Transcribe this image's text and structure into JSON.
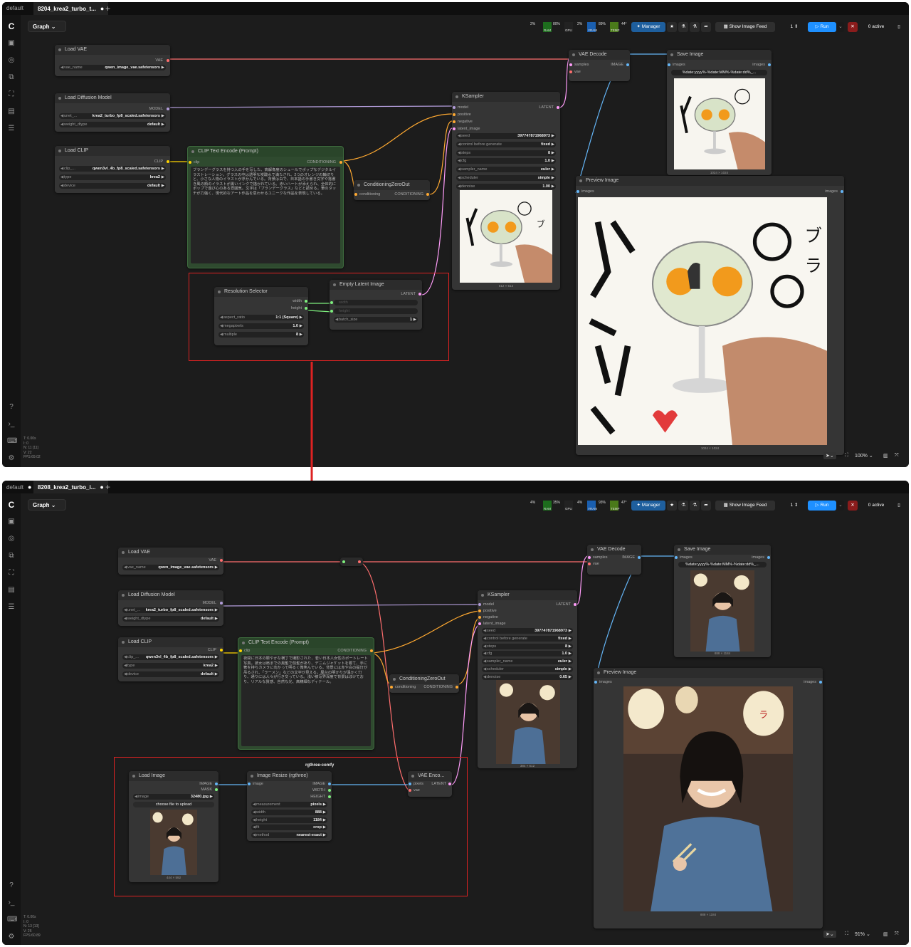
{
  "top": {
    "tabs": [
      {
        "label": "default"
      },
      {
        "label": "8204_krea2_turbo_t..."
      }
    ],
    "graph_label": "Graph",
    "stats": "T: 0.00s\nI: 0\nN: 11 [11]\nV: 22\nFPS:69.02",
    "toolbar": {
      "cpu_pct": "2%",
      "cpu_label": "CPU",
      "ram_pct": "80%",
      "ram_label": "RAM",
      "gpu_pct": "2%",
      "gpu_label": "GPU",
      "vram_pct": "89%",
      "vram_label": "VRAM",
      "temp": "44°",
      "temp_label": "TEMP",
      "manager": "Manager",
      "feed": "Show Image Feed",
      "queue": "1",
      "run": "Run",
      "active": "0 active"
    },
    "zoom": "100%",
    "nodes": {
      "load_vae": {
        "title": "Load VAE",
        "out": "VAE",
        "w_label": "vae_name",
        "w_value": "qwen_image_vae.safetensors"
      },
      "load_diffusion": {
        "title": "Load Diffusion Model",
        "out": "MODEL",
        "w1_label": "unet_...",
        "w1_value": "krea2_turbo_fp8_scaled.safetensors",
        "w2_label": "weight_dtype",
        "w2_value": "default"
      },
      "load_clip": {
        "title": "Load CLIP",
        "out": "CLIP",
        "w1_label": "clip_...",
        "w1_value": "qwen3vl_4b_fp8_scaled.safetensors",
        "w2_label": "type",
        "w2_value": "krea2",
        "w3_label": "device",
        "w3_value": "default"
      },
      "clip_text": {
        "title": "CLIP Text Encode (Prompt)",
        "in": "clip",
        "out": "CONDITIONING",
        "text": "ブランデーグラスを持つ人の手を写した、高解像度のシュールでポップなデジタルイラストレーション。グラスの中は透明な炭酸水で満たされ、2つのオレンジの輪切りと、小さな人物のイラストが浮かんでいる。背景は白で、日本語の手書き文字や落書き風の顔のイラストが黒いインクで描かれている。赤いハートが添えられ、全体的にポップで遊び心のある雰囲気。文字は「ブランデーグラス」などと読める。筆のタッチが力強く、現代的なアート作品を思わせるユニークな作品を表現している。"
      },
      "cond_zero": {
        "title": "ConditioningZeroOut",
        "in": "conditioning",
        "out": "CONDITIONING"
      },
      "ksampler": {
        "title": "KSampler",
        "in_model": "model",
        "in_positive": "positive",
        "in_negative": "negative",
        "in_latent": "latent_image",
        "out": "LATENT",
        "widgets": [
          {
            "label": "seed",
            "value": "397747871968973"
          },
          {
            "label": "control before generate",
            "value": "fixed"
          },
          {
            "label": "steps",
            "value": "8"
          },
          {
            "label": "cfg",
            "value": "1.0"
          },
          {
            "label": "sampler_name",
            "value": "euler"
          },
          {
            "label": "scheduler",
            "value": "simple"
          },
          {
            "label": "denoise",
            "value": "1.00"
          }
        ],
        "caption": "512 × 512"
      },
      "vae_decode": {
        "title": "VAE Decode",
        "in_samples": "samples",
        "in_vae": "vae",
        "out": "IMAGE"
      },
      "save_image": {
        "title": "Save Image",
        "in": "images",
        "out": "images",
        "filename": "%date:yyyy%-%date:MM%-%date:dd%_...",
        "caption": "1024 × 1024"
      },
      "preview": {
        "title": "Preview Image",
        "in": "images",
        "out": "images",
        "caption": "1024 × 1024"
      },
      "res_selector": {
        "title": "Resolution Selector",
        "out_w": "width",
        "out_h": "height",
        "widgets": [
          {
            "label": "aspect_ratio",
            "value": "1:1 (Square)"
          },
          {
            "label": "megapixels",
            "value": "1.0"
          },
          {
            "label": "multiple",
            "value": "8"
          }
        ]
      },
      "empty_latent": {
        "title": "Empty Latent Image",
        "out": "LATENT",
        "w1": "width",
        "w2": "height",
        "w3_label": "batch_size",
        "w3_value": "1"
      }
    }
  },
  "bottom": {
    "tabs": [
      {
        "label": "default"
      },
      {
        "label": "8208_krea2_turbo_i..."
      }
    ],
    "graph_label": "Graph",
    "stats": "T: 0.00s\nI: 0\nN: 13 [13]\nV: 26\nFPS:60.89",
    "toolbar": {
      "cpu_pct": "4%",
      "cpu_label": "CPU",
      "ram_pct": "35%",
      "ram_label": "RAM",
      "gpu_pct": "4%",
      "gpu_label": "GPU",
      "vram_pct": "93%",
      "vram_label": "VRAM",
      "temp": "47°",
      "temp_label": "TEMP",
      "manager": "Manager",
      "feed": "Show Image Feed",
      "queue": "1",
      "run": "Run",
      "active": "0 active"
    },
    "zoom": "91%",
    "group_label": "rgthree-comfy",
    "nodes": {
      "load_vae": {
        "title": "Load VAE",
        "out": "VAE",
        "w_label": "vae_name",
        "w_value": "qwen_image_vae.safetensors"
      },
      "load_diffusion": {
        "title": "Load Diffusion Model",
        "out": "MODEL",
        "w1_label": "unet_...",
        "w1_value": "krea2_turbo_fp8_scaled.safetensors",
        "w2_label": "weight_dtype",
        "w2_value": "default"
      },
      "load_clip": {
        "title": "Load CLIP",
        "out": "CLIP",
        "w1_label": "clip_...",
        "w1_value": "qwen3vl_4b_fp8_scaled.safetensors",
        "w2_label": "type",
        "w2_value": "krea2",
        "w3_label": "device",
        "w3_value": "default"
      },
      "clip_text": {
        "title": "CLIP Text Encode (Prompt)",
        "in": "clip",
        "out": "CONDITIONING",
        "text": "夜間に日本の賑やかな横丁で撮影された、若い日本人女性のポートレート写真。彼女は肩までの黒髪で前髪があり、デニムジャケットを着て、手に箸を持ちカメラに向かって明るく微笑んでいる。背景には赤や白の提灯が吊るされ、「ラーメン」などの文字が見える。屋台の明かりが温かく灯り、通りには人々が行き交っている。浅い被写界深度で背景はぼけており、リアルな質感、自然な光、高精細なディテール。"
      },
      "cond_zero": {
        "title": "ConditioningZeroOut",
        "in": "conditioning",
        "out": "CONDITIONING"
      },
      "ksampler": {
        "title": "KSampler",
        "in_model": "model",
        "in_positive": "positive",
        "in_negative": "negative",
        "in_latent": "latent_image",
        "out": "LATENT",
        "widgets": [
          {
            "label": "seed",
            "value": "397747871968973"
          },
          {
            "label": "control before generate",
            "value": "fixed"
          },
          {
            "label": "steps",
            "value": "8"
          },
          {
            "label": "cfg",
            "value": "1.0"
          },
          {
            "label": "sampler_name",
            "value": "euler"
          },
          {
            "label": "scheduler",
            "value": "simple"
          },
          {
            "label": "denoise",
            "value": "0.65"
          }
        ],
        "caption": "384 × 512"
      },
      "vae_decode": {
        "title": "VAE Decode",
        "in_samples": "samples",
        "in_vae": "vae",
        "out": "IMAGE"
      },
      "save_image": {
        "title": "Save Image",
        "in": "images",
        "out": "images",
        "filename": "%date:yyyy%-%date:MM%-%date:dd%_...",
        "caption": "888 × 1184"
      },
      "preview": {
        "title": "Preview Image",
        "in": "images",
        "out": "images",
        "caption": "888 × 1184"
      },
      "load_image": {
        "title": "Load Image",
        "out_image": "IMAGE",
        "out_mask": "MASK",
        "w_label": "image",
        "w_value": "32480.jpg",
        "upload": "choose file to upload",
        "caption": "444 × 592"
      },
      "image_resize": {
        "title": "Image Resize (rgthree)",
        "in": "image",
        "out_image": "IMAGE",
        "out_w": "WIDTH",
        "out_h": "HEIGHT",
        "widgets": [
          {
            "label": "measurement",
            "value": "pixels"
          },
          {
            "label": "width",
            "value": "888"
          },
          {
            "label": "height",
            "value": "1184"
          },
          {
            "label": "fit",
            "value": "crop"
          },
          {
            "label": "method",
            "value": "nearest-exact"
          }
        ]
      },
      "vae_encode": {
        "title": "VAE Enco...",
        "in_pixels": "pixels",
        "in_vae": "vae",
        "out": "LATENT"
      }
    }
  },
  "colors": {
    "vae": "#ff6e6e",
    "model": "#b39ddb",
    "clip": "#ffd500",
    "cond": "#ffa931",
    "latent": "#ff9cf9",
    "image": "#64b5f6",
    "int": "#7ef07e",
    "red_box": "#dd2222",
    "run": "#1e90ff"
  },
  "icons": [
    "comfy-logo",
    "images-icon",
    "nodes-icon",
    "models-icon",
    "workflows-icon",
    "templates-icon",
    "queue-icon",
    "help-icon",
    "terminal-icon",
    "keyboard-icon",
    "settings-icon"
  ]
}
